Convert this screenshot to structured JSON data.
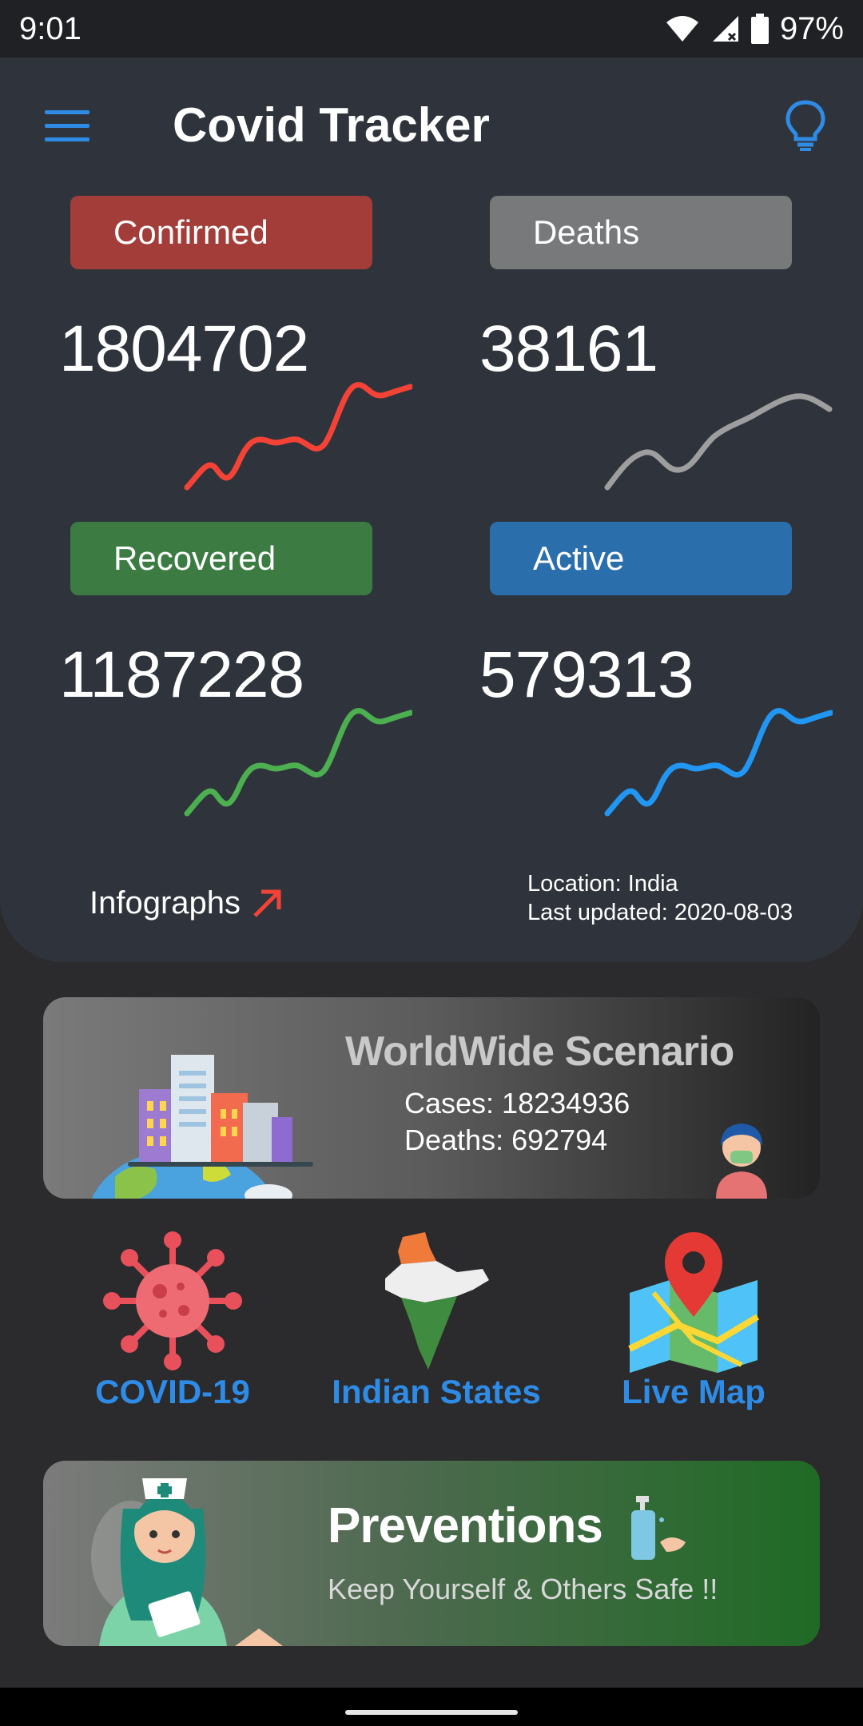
{
  "status_bar": {
    "time": "9:01",
    "battery": "97%"
  },
  "header": {
    "title": "Covid Tracker",
    "menu_icon": "hamburger-menu-icon",
    "theme_icon": "lightbulb-icon"
  },
  "stats": {
    "confirmed": {
      "label": "Confirmed",
      "value": "1804702",
      "color": "#f44336"
    },
    "deaths": {
      "label": "Deaths",
      "value": "38161",
      "color": "#9e9e9e"
    },
    "recovered": {
      "label": "Recovered",
      "value": "1187228",
      "color": "#4caf50"
    },
    "active": {
      "label": "Active",
      "value": "579313",
      "color": "#2196f3"
    }
  },
  "infographs": {
    "label": "Infographs",
    "icon": "arrow-up-right-icon"
  },
  "meta": {
    "location": "Location: India",
    "updated": "Last updated: 2020-08-03"
  },
  "worldwide": {
    "title": "WorldWide Scenario",
    "cases": "Cases: 18234936",
    "deaths": "Deaths: 692794"
  },
  "shortcuts": [
    {
      "label": "COVID-19",
      "icon": "virus-icon"
    },
    {
      "label": "Indian States",
      "icon": "india-map-icon"
    },
    {
      "label": "Live Map",
      "icon": "map-pin-icon"
    }
  ],
  "preventions": {
    "title": "Preventions",
    "subtitle": "Keep Yourself & Others Safe !!"
  },
  "colors": {
    "accent": "#2e8be6",
    "panel": "#2f343c",
    "background": "#2b2b2d"
  }
}
